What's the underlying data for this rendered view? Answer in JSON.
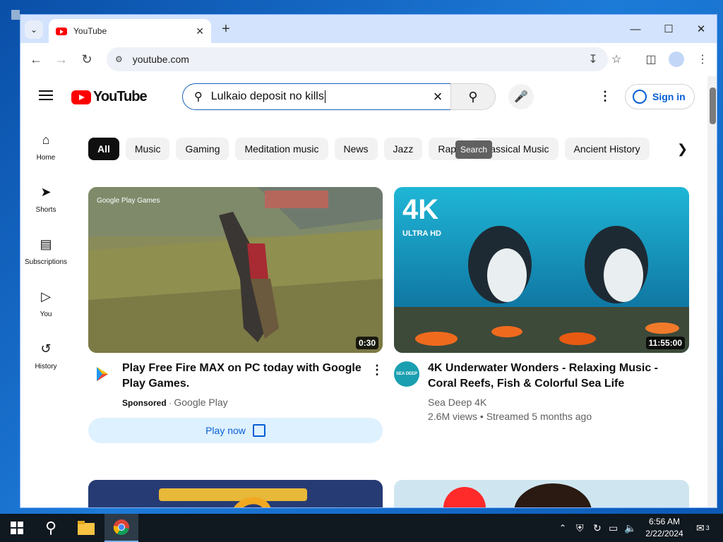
{
  "browser": {
    "tab_title": "YouTube",
    "url": "youtube.com"
  },
  "youtube": {
    "logo_text": "YouTube",
    "search_value": "Lulkaio deposit no kills",
    "search_tooltip": "Search",
    "sign_in_label": "Sign in",
    "sidebar": [
      {
        "label": "Home",
        "icon": "home-icon"
      },
      {
        "label": "Shorts",
        "icon": "shorts-icon"
      },
      {
        "label": "Subscriptions",
        "icon": "subscriptions-icon"
      },
      {
        "label": "You",
        "icon": "you-icon"
      },
      {
        "label": "History",
        "icon": "history-icon"
      }
    ],
    "chips": [
      "All",
      "Music",
      "Gaming",
      "Meditation music",
      "News",
      "Jazz",
      "Rap",
      "Classical Music",
      "Ancient History"
    ],
    "videos": [
      {
        "title": "Play Free Fire MAX on PC today with Google Play Games.",
        "sponsored_label": "Sponsored",
        "channel": "Google Play",
        "duration": "0:30",
        "cta": "Play now"
      },
      {
        "title": "4K Underwater Wonders - Relaxing Music - Coral Reefs, Fish & Colorful Sea Life",
        "channel": "Sea Deep 4K",
        "stats": "2.6M views • Streamed 5 months ago",
        "duration": "11:55:00",
        "thumb_badge_main": "4K",
        "thumb_badge_sub": "ULTRA HD",
        "avatar_text": "SEA DEEP"
      }
    ],
    "overlay_text": "Google Play Games"
  },
  "taskbar": {
    "time": "6:56 AM",
    "date": "2/22/2024",
    "notifications": "3"
  },
  "colors": {
    "yt_red": "#ff0000",
    "link_blue": "#065fd4",
    "taskbar_bg": "#101820"
  }
}
